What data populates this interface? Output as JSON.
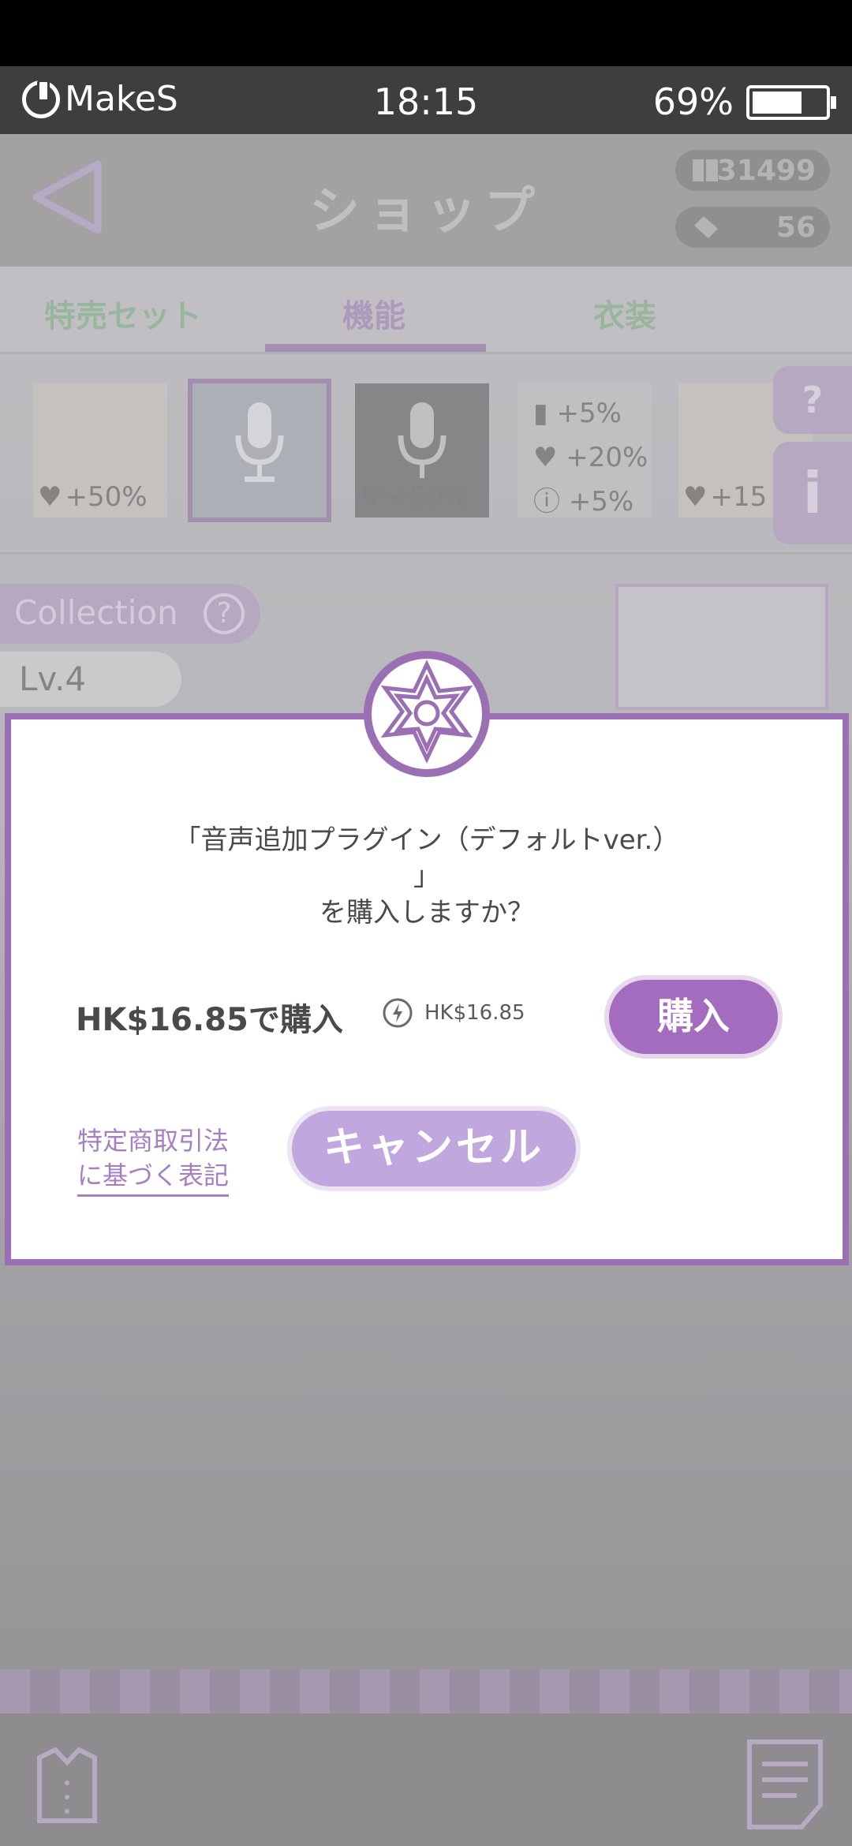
{
  "status_bar": {
    "brand": "MakeS",
    "time": "18:15",
    "battery": "69%",
    "battery_level": 0.69
  },
  "header": {
    "title": "ショップ",
    "currency_tickets": "31499",
    "currency_tags": "56"
  },
  "tabs": [
    {
      "label": "特売セット",
      "active": false
    },
    {
      "label": "機能",
      "active": true
    },
    {
      "label": "衣装",
      "active": false
    }
  ],
  "items": [
    {
      "bonus": "+50%"
    },
    {
      "bonus": ""
    },
    {
      "bonus": "+50%"
    },
    {
      "bonus_lines": [
        "+5%",
        "+20%",
        "+5%"
      ]
    },
    {
      "bonus": "+15"
    }
  ],
  "side_buttons": {
    "help": "?",
    "info": "i"
  },
  "collection": {
    "label": "Collection",
    "help": "?",
    "level": "Lv.4"
  },
  "modal": {
    "message_line1": "「音声追加プラグイン（デフォルトver.）",
    "message_line2": "」",
    "message_line3": "を購入しますか？",
    "price_label": "HK$16.85で購入",
    "price_alt": "HK$16.85",
    "buy_button": "購入",
    "legal_line1": "特定商取引法",
    "legal_line2": "に基づく表記",
    "cancel_button": "キャンセル"
  },
  "colors": {
    "accent_purple": "#a46cbf",
    "tab_green": "#7aa87e",
    "modal_border": "#9a6fb4"
  }
}
